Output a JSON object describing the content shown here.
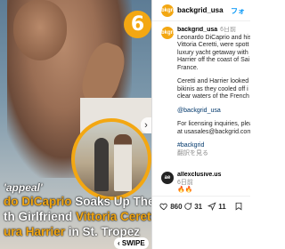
{
  "post_image": {
    "logo_glyph": "6",
    "caption_lines": [
      {
        "pre": "'appeal'",
        "hl": ""
      },
      {
        "pre": "do DiCaprio",
        "hl": "",
        "post": " Soaks Up The"
      },
      {
        "pre": "th Girlfriend ",
        "hl": "Vittoria Ceretti",
        "post": ""
      },
      {
        "pre": "",
        "hl": "ura Harrier",
        "post": " in St. Tropez"
      }
    ],
    "nav_arrow": "›",
    "swipe_label": "‹ SWIPE"
  },
  "header": {
    "avatar_text": "bkgrid",
    "username": "backgrid_usa",
    "follow_label": "フォ"
  },
  "caption": {
    "avatar_text": "bkgrid",
    "username": "backgrid_usa",
    "time": "6日前",
    "lines_p1": [
      "Leonardo DiCaprio and his",
      "Vittoria Ceretti, were spott",
      "luxury yacht getaway with",
      "Harrier off the coast of Sai",
      "France."
    ],
    "lines_p2": [
      "Ceretti and Harrier looked",
      "bikinis as they cooled off i",
      "clear waters of the French"
    ],
    "mention": "@backgrid_usa",
    "lines_p3": [
      "For licensing inquiries, plea",
      "at usasales@backgrid.com"
    ],
    "hashtag": "#backgrid",
    "translate": "翻訳を見る"
  },
  "comment": {
    "avatar_text": "ae",
    "username": "allexclusive.us",
    "time": "6日前",
    "text": "🔥🔥"
  },
  "actions": {
    "likes": "860",
    "comments": "31",
    "shares": "11"
  },
  "colors": {
    "brand": "#f3a712",
    "link": "#0095f6"
  }
}
